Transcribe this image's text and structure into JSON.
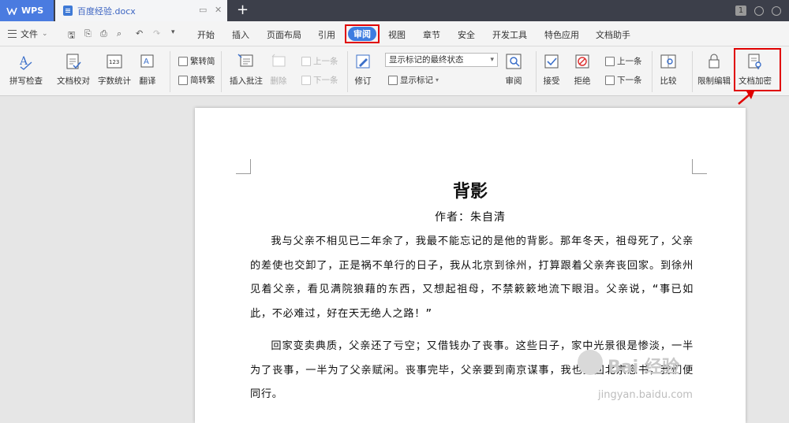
{
  "titlebar": {
    "app_tab": "WPS",
    "doc_tab": "百度经验.docx",
    "badge": "1"
  },
  "menubar": {
    "file": "文件",
    "items": [
      "开始",
      "插入",
      "页面布局",
      "引用",
      "审阅",
      "视图",
      "章节",
      "安全",
      "开发工具",
      "特色应用",
      "文档助手"
    ],
    "active": "审阅"
  },
  "ribbon": {
    "spellcheck": "拼写检查",
    "doc_check": "文档校对",
    "word_count": "字数统计",
    "translate": "翻译",
    "trad_simp": "繁转简",
    "simp_trad": "简转繁",
    "insert_comment": "插入批注",
    "delete": "删除",
    "prev_comment": "上一条",
    "next_comment": "下一条",
    "revise": "修订",
    "display_state": "显示标记的最终状态",
    "show_markup": "显示标记",
    "review": "审阅",
    "accept": "接受",
    "reject": "拒绝",
    "prev": "上一条",
    "next": "下一条",
    "compare": "比较",
    "restrict_edit": "限制编辑",
    "doc_encrypt": "文档加密"
  },
  "document": {
    "title": "背影",
    "author": "作者：朱自清",
    "para1": "我与父亲不相见已二年余了，我最不能忘记的是他的背影。那年冬天，祖母死了，父亲的差使也交卸了，正是祸不单行的日子，我从北京到徐州，打算跟着父亲奔丧回家。到徐州见着父亲，看见满院狼藉的东西，又想起祖母，不禁簌簌地流下眼泪。父亲说，“事已如此，不必难过，好在天无绝人之路！”",
    "para2": "回家变卖典质，父亲还了亏空；又借钱办了丧事。这些日子，家中光景很是惨淡，一半为了丧事，一半为了父亲赋闲。丧事完毕，父亲要到南京谋事，我也要回北京念书，我们便同行。"
  },
  "watermark": {
    "brand": "Bai 经验",
    "url": "jingyan.baidu.com"
  },
  "colors": {
    "accent": "#3d7ce0",
    "highlight": "#e00000",
    "titlebar": "#3c3f4a"
  }
}
